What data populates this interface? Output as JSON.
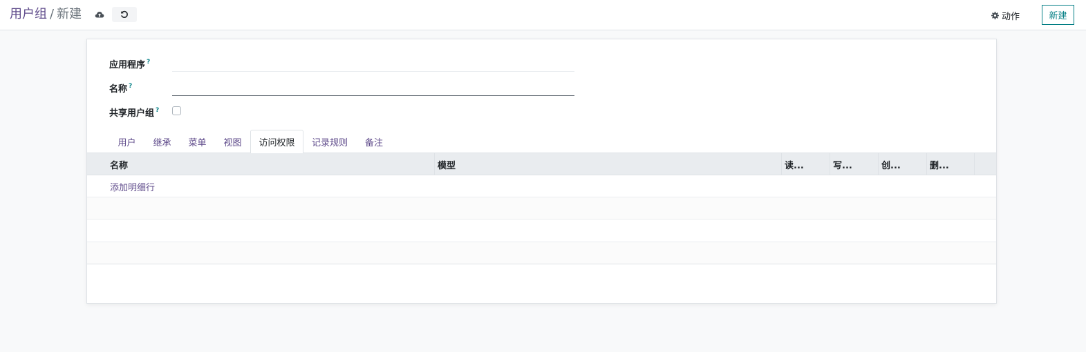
{
  "breadcrumb": {
    "parent": "用户组",
    "separator": "/",
    "current": "新建"
  },
  "toolbar": {
    "save_icon": "cloud-upload-icon",
    "discard_icon": "undo-icon",
    "action_label": "动作",
    "action_icon": "gear-icon",
    "new_label": "新建"
  },
  "form": {
    "application_label": "应用程序",
    "application_value": "",
    "name_label": "名称",
    "name_value": "",
    "share_label": "共享用户组",
    "share_checked": false,
    "help_mark": "?"
  },
  "tabs": [
    {
      "label": "用户",
      "active": false
    },
    {
      "label": "继承",
      "active": false
    },
    {
      "label": "菜单",
      "active": false
    },
    {
      "label": "视图",
      "active": false
    },
    {
      "label": "访问权限",
      "active": true
    },
    {
      "label": "记录规则",
      "active": false
    },
    {
      "label": "备注",
      "active": false
    }
  ],
  "table": {
    "columns": [
      "名称",
      "模型",
      "读...",
      "写...",
      "创...",
      "删..."
    ],
    "add_line_label": "添加明细行",
    "rows": []
  },
  "colors": {
    "link": "#5f4b8b",
    "accent": "#017e84",
    "header_bg": "#e9ecef",
    "page_bg": "#f8f9fa"
  }
}
